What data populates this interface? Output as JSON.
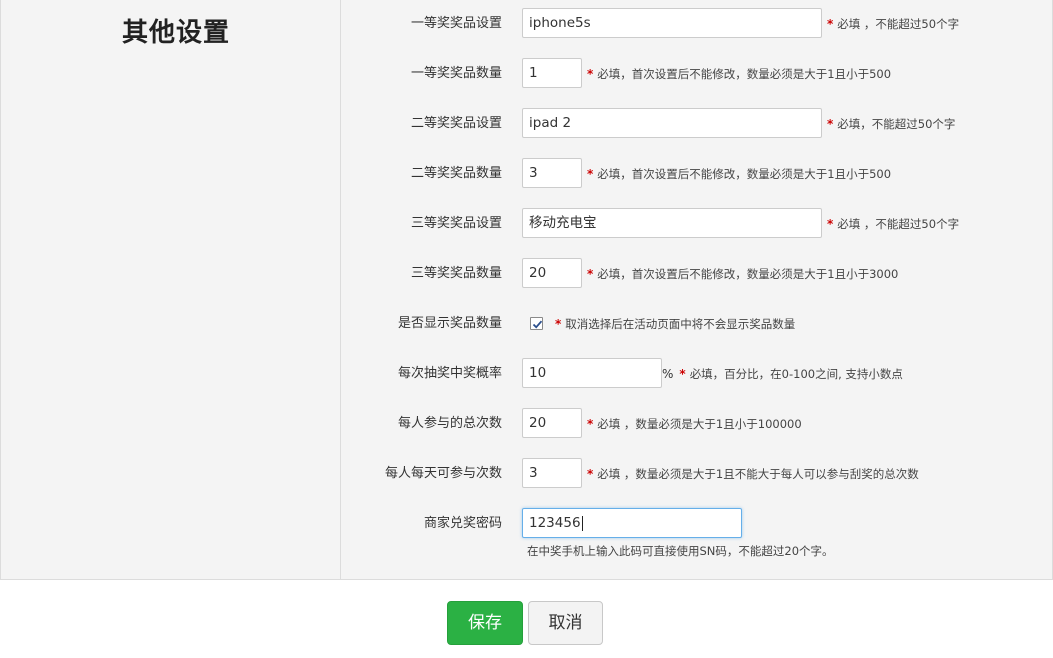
{
  "section_title": "其他设置",
  "required_mark": "*",
  "fields": {
    "prize1_name": {
      "label": "一等奖奖品设置",
      "value": "iphone5s",
      "hint": "必填 ，不能超过50个字"
    },
    "prize1_count": {
      "label": "一等奖奖品数量",
      "value": "1",
      "hint": "必填，首次设置后不能修改，数量必须是大于1且小于500"
    },
    "prize2_name": {
      "label": "二等奖奖品设置",
      "value": "ipad 2",
      "hint": "必填，不能超过50个字"
    },
    "prize2_count": {
      "label": "二等奖奖品数量",
      "value": "3",
      "hint": "必填，首次设置后不能修改，数量必须是大于1且小于500"
    },
    "prize3_name": {
      "label": "三等奖奖品设置",
      "value": "移动充电宝",
      "hint": "必填 ，不能超过50个字"
    },
    "prize3_count": {
      "label": "三等奖奖品数量",
      "value": "20",
      "hint": "必填，首次设置后不能修改，数量必须是大于1且小于3000"
    },
    "show_count": {
      "label": "是否显示奖品数量",
      "checked": true,
      "hint": "取消选择后在活动页面中将不会显示奖品数量"
    },
    "win_rate": {
      "label": "每次抽奖中奖概率",
      "value": "10",
      "unit": "%",
      "hint": "必填，百分比，在0-100之间, 支持小数点"
    },
    "total_times": {
      "label": "每人参与的总次数",
      "value": "20",
      "hint": "必填 ，数量必须是大于1且小于100000"
    },
    "daily_times": {
      "label": "每人每天可参与次数",
      "value": "3",
      "hint": "必填 ，数量必须是大于1且不能大于每人可以参与刮奖的总次数"
    },
    "merchant_pwd": {
      "label": "商家兑奖密码",
      "value": "123456",
      "hint": "在中奖手机上输入此码可直接使用SN码，不能超过20个字。"
    }
  },
  "buttons": {
    "save": "保存",
    "cancel": "取消"
  },
  "colors": {
    "save_bg": "#2bb144",
    "required": "#cc0000",
    "checkbox_check": "#2a4e8c"
  }
}
